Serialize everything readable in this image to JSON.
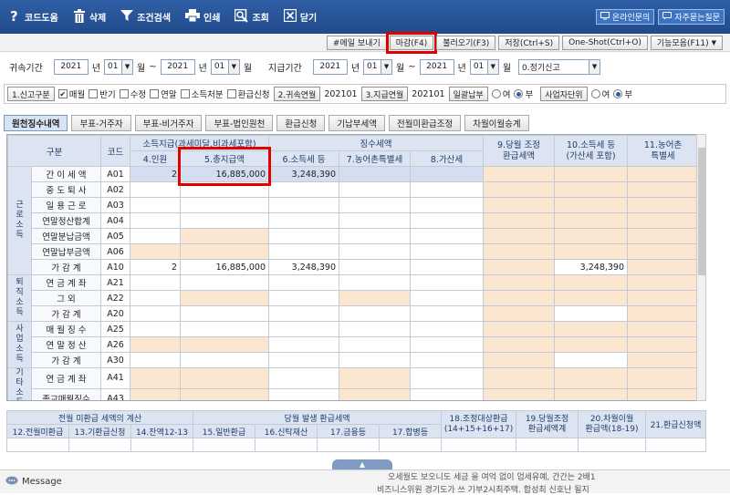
{
  "toolbar": {
    "code_help": "코드도움",
    "delete": "삭제",
    "search": "조건검색",
    "print": "인쇄",
    "lookup": "조회",
    "close": "닫기",
    "online_inquiry": "온라인문의",
    "faq": "자주묻는질문"
  },
  "actions": {
    "email": "#메일 보내기",
    "close_f4": "마감(F4)",
    "load_f3": "불러오기(F3)",
    "save": "저장(Ctrl+S)",
    "oneshot": "One-Shot(Ctrl+O)",
    "features": "기능모음(F11)"
  },
  "period": {
    "attr_label": "귀속기간",
    "attr_year_from": "2021",
    "year_unit": "년",
    "attr_month_from": "01",
    "month_unit": "월",
    "tilde": "~",
    "attr_year_to": "2021",
    "attr_month_to": "01",
    "pay_label": "지급기간",
    "pay_year_from": "2021",
    "pay_month_from": "01",
    "pay_year_to": "2021",
    "pay_month_to": "01",
    "filing_type": "0.정기신고"
  },
  "options": {
    "filing_kind_btn": "1.신고구분",
    "monthly": "매월",
    "half_year": "반기",
    "amended": "수정",
    "year_end": "연말",
    "income_disposal": "소득처분",
    "refund_request": "환급신청",
    "attr_ym_btn": "2.귀속연월",
    "attr_ym": "202101",
    "pay_ym_btn": "3.지급연월",
    "pay_ym": "202101",
    "batch_pay_btn": "일괄납부",
    "yes": "여",
    "no": "부",
    "unit_btn": "사업자단위"
  },
  "tabs": [
    "원천징수내역",
    "부표-거주자",
    "부표-비거주자",
    "부표-법인원천",
    "환급신청",
    "기납부세액",
    "전월미환급조정",
    "차월이월승계"
  ],
  "grid": {
    "h_category": "구분",
    "h_code": "코드",
    "h_income_group": "소득지급(과세미달,비과세포함)",
    "h_tax_group": "징수세액",
    "h_people": "4.인원",
    "h_total_pay": "5.총지급액",
    "h_income_tax": "6.소득세 등",
    "h_rural_tax": "7.농어촌특별세",
    "h_add_tax": "8.가산세",
    "h_adj_refund": "9.당월 조정\n환급세액",
    "h_income_tax_incl": "10.소득세 등\n(가산세 포함)",
    "h_rural_special": "11.농어촌\n특별세",
    "groups": {
      "labor": "근로소득",
      "retire": "퇴직소득",
      "business": "사업소득",
      "other": "기타소득"
    },
    "rows": [
      {
        "label": "간 이 세 액",
        "code": "A01",
        "people": "2",
        "total": "16,885,000",
        "tax": "3,248,390",
        "tax10": ""
      },
      {
        "label": "중 도 퇴 사",
        "code": "A02",
        "people": "",
        "total": "",
        "tax": "",
        "tax10": ""
      },
      {
        "label": "일 용 근 로",
        "code": "A03",
        "people": "",
        "total": "",
        "tax": "",
        "tax10": ""
      },
      {
        "label": "연말정산합계",
        "code": "A04",
        "people": "",
        "total": "",
        "tax": "",
        "tax10": ""
      },
      {
        "label": "연말분납금액",
        "code": "A05",
        "people": "",
        "total": "",
        "tax": "",
        "tax10": ""
      },
      {
        "label": "연말납부금액",
        "code": "A06",
        "people": "",
        "total": "",
        "tax": "",
        "tax10": ""
      },
      {
        "label": "가 감 계",
        "code": "A10",
        "people": "2",
        "total": "16,885,000",
        "tax": "3,248,390",
        "tax10": "3,248,390"
      },
      {
        "label": "연 금 계 좌",
        "code": "A21",
        "people": "",
        "total": "",
        "tax": "",
        "tax10": ""
      },
      {
        "label": "그 외",
        "code": "A22",
        "people": "",
        "total": "",
        "tax": "",
        "tax10": ""
      },
      {
        "label": "가 감 계",
        "code": "A20",
        "people": "",
        "total": "",
        "tax": "",
        "tax10": ""
      },
      {
        "label": "매 월 징 수",
        "code": "A25",
        "people": "",
        "total": "",
        "tax": "",
        "tax10": ""
      },
      {
        "label": "연 말 정 산",
        "code": "A26",
        "people": "",
        "total": "",
        "tax": "",
        "tax10": ""
      },
      {
        "label": "가 감 계",
        "code": "A30",
        "people": "",
        "total": "",
        "tax": "",
        "tax10": ""
      },
      {
        "label": "연 금 계 좌",
        "code": "A41",
        "people": "",
        "total": "",
        "tax": "",
        "tax10": ""
      },
      {
        "label": "종교매월징수",
        "code": "A43",
        "people": "",
        "total": "",
        "tax": "",
        "tax10": ""
      }
    ]
  },
  "summary": {
    "prev_group": "전월 미환급 세액의 계산",
    "curr_group": "당월 발생 환급세액",
    "c12": "12.전월미환급",
    "c13": "13.기환급신청",
    "c14": "14.잔액12-13",
    "c15": "15.일반환급",
    "c16": "16.신탁재산",
    "c17": "17.금융등",
    "c17b": "17.합병등",
    "c18": "18.조정대상환급\n(14+15+16+17)",
    "c19": "19.당월조정\n환급세액계",
    "c20": "20.차월이월\n환급액(18-19)",
    "c21": "21.환급신청액"
  },
  "status": {
    "message": "Message",
    "ghost1": "오세월도  보오니도 세금 을 여억 없이  업세유예, 간간는 2배1",
    "ghost2": "비즈니스위원  경기도가 쓰 기부2시최주택. 합성최 신호난 될지"
  }
}
